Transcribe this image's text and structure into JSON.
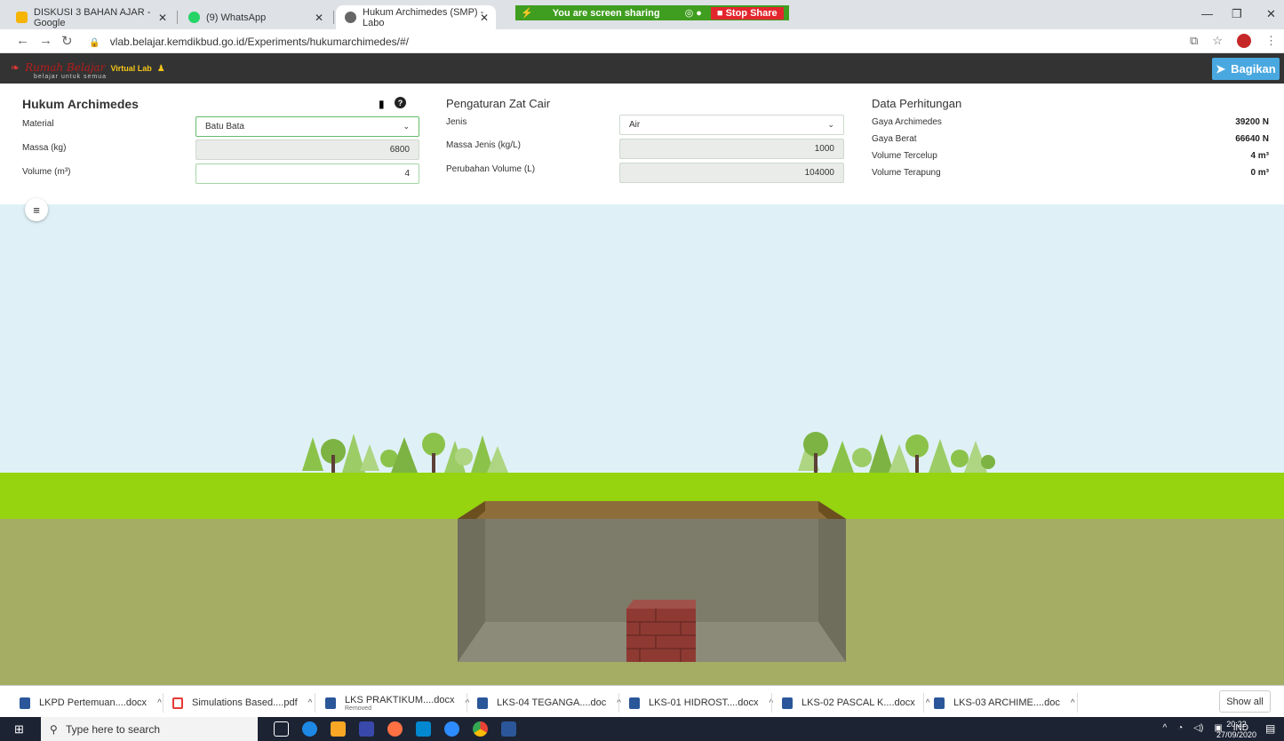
{
  "browser": {
    "tabs": [
      {
        "title": "DISKUSI 3 BAHAN AJAR - Google",
        "close": "✕"
      },
      {
        "title": "(9) WhatsApp",
        "close": "✕"
      },
      {
        "title": "Hukum Archimedes (SMP) - Labo",
        "close": "✕"
      }
    ],
    "screen_share": {
      "text": "You are screen sharing",
      "stop": "Stop Share"
    },
    "url": "vlab.belajar.kemdikbud.go.id/Experiments/hukumarchimedes/#/",
    "window_controls": {
      "minimize": "—",
      "restore": "❐",
      "close": "✕"
    }
  },
  "app": {
    "logo_script": "Rumah Belajar",
    "logo_sub": "belajar untuk semua",
    "logo_vlab": "Virtual Lab",
    "share_button": "Bagikan"
  },
  "panel": {
    "left": {
      "title": "Hukum Archimedes",
      "material_label": "Material",
      "material_value": "Batu Bata",
      "massa_label": "Massa (kg)",
      "massa_value": "6800",
      "volume_label": "Volume (m³)",
      "volume_value": "4"
    },
    "middle": {
      "title": "Pengaturan Zat Cair",
      "jenis_label": "Jenis",
      "jenis_value": "Air",
      "massa_jenis_label": "Massa Jenis (kg/L)",
      "massa_jenis_value": "1000",
      "perubahan_label": "Perubahan Volume (L)",
      "perubahan_value": "104000"
    },
    "right": {
      "title": "Data Perhitungan",
      "rows": [
        {
          "label": "Gaya Archimedes",
          "value": "39200 N"
        },
        {
          "label": "Gaya Berat",
          "value": "66640 N"
        },
        {
          "label": "Volume Tercelup",
          "value": "4 m³"
        },
        {
          "label": "Volume Terapung",
          "value": "0 m³"
        }
      ]
    }
  },
  "downloads": {
    "items": [
      {
        "name": "LKPD Pertemuan....docx",
        "sub": ""
      },
      {
        "name": "Simulations Based....pdf",
        "sub": ""
      },
      {
        "name": "LKS PRAKTIKUM....docx",
        "sub": "Removed"
      },
      {
        "name": "LKS-04 TEGANGA....doc",
        "sub": ""
      },
      {
        "name": "LKS-01 HIDROST....docx",
        "sub": ""
      },
      {
        "name": "LKS-02 PASCAL K....docx",
        "sub": ""
      },
      {
        "name": "LKS-03 ARCHIME....doc",
        "sub": ""
      }
    ],
    "show_all": "Show all"
  },
  "taskbar": {
    "search_placeholder": "Type here to search",
    "language": "IND",
    "time": "20:22",
    "date": "27/09/2020"
  },
  "colors": {
    "sky": "#dff1f7",
    "grass": "#95d40f",
    "ground": "#a4ad63",
    "tank_rim": "#6b4f1f",
    "brick": "#8e3a33",
    "header": "#333333",
    "accent": "#4aa8e0"
  }
}
